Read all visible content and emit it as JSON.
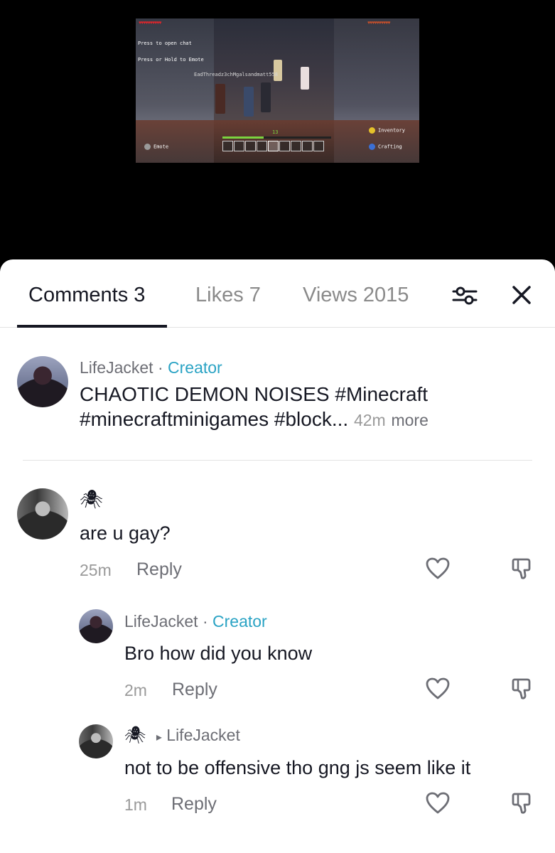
{
  "video": {
    "hud": {
      "chat_hint": "Press  to open chat",
      "emote_hint": "Press or Hold  to Emote",
      "player_tag": "EadThreadz3chMgalsandmatt558",
      "level": "13",
      "inventory": "Inventory",
      "crafting": "Crafting",
      "emote": "Emote"
    }
  },
  "tabs": [
    {
      "label": "Comments 3"
    },
    {
      "label": "Likes 7"
    },
    {
      "label": "Views 2015"
    }
  ],
  "caption_post": {
    "author": "LifeJacket",
    "dot": "·",
    "badge": "Creator",
    "line1": "CHAOTIC DEMON NOISES  #Minecraft",
    "line2": "#minecraftminigames #block...",
    "time": "42m",
    "more": "more"
  },
  "comments": [
    {
      "author_glyph": "🕷",
      "text": "are u gay?",
      "time": "25m",
      "reply": "Reply"
    },
    {
      "author": "LifeJacket",
      "dot": "·",
      "badge": "Creator",
      "text": "Bro how did you know",
      "time": "2m",
      "reply": "Reply"
    },
    {
      "author_glyph": "🕷",
      "reply_to_arrow": "▸",
      "reply_to": "LifeJacket",
      "text": "not to be offensive tho gng js seem like it",
      "time": "1m",
      "reply": "Reply"
    }
  ],
  "icons": {
    "filter": "filter-icon",
    "close": "close-icon",
    "like": "heart-icon",
    "dislike": "thumbs-down-icon"
  },
  "colors": {
    "creator_badge": "#2aa3c4",
    "text_primary": "#161823",
    "text_secondary": "#6d6e75"
  }
}
